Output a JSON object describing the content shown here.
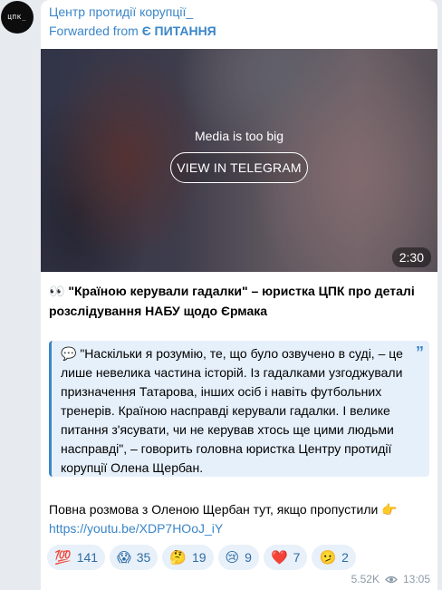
{
  "avatar": {
    "text": "ЦПК_"
  },
  "message": {
    "channel_name": "Центр протидії корупції_",
    "forwarded_prefix": "Forwarded from ",
    "forwarded_source": "Є ПИТАННЯ",
    "media": {
      "notice": "Media is too big",
      "button_label": "VIEW IN TELEGRAM",
      "duration": "2:30"
    },
    "headline_emoji": "👀",
    "headline": "\"Країною керували гадалки\" – юристка ЦПК про деталі розслідування НАБУ щодо Єрмака",
    "quote": {
      "emoji": "💬",
      "text": "\"Наскільки я розумію, те, що було озвучено в суді, – це лише невелика частина історій. Із гадалками узгоджували призначення Татарова, інших осіб і навіть футбольних тренерів. Країною насправді керували гадалки. І велике питання з'ясувати, чи не керував хтось ще цими людьми насправді\", – говорить головна юристка Центру протидії корупції Олена Щербан.",
      "mark": "”"
    },
    "paragraph": "Повна розмова з Оленою Щербан тут, якщо пропустили",
    "paragraph_emoji": "👉",
    "link": "https://youtu.be/XDP7HOoJ_iY",
    "reactions": [
      {
        "emoji": "💯",
        "count": "141"
      },
      {
        "emoji": "😱",
        "count": "35"
      },
      {
        "emoji": "🤔",
        "count": "19"
      },
      {
        "emoji": "😢",
        "count": "9"
      },
      {
        "emoji": "❤️",
        "count": "7"
      },
      {
        "emoji": "🫤",
        "count": "2"
      }
    ],
    "views": "5.52K",
    "views_icon": "eye-icon",
    "time": "13:05"
  },
  "colors": {
    "accent": "#3a86c8",
    "background": "#e7ebf0",
    "quote_bg": "#e6f0fb",
    "reaction_bg": "#e8f0f9"
  }
}
